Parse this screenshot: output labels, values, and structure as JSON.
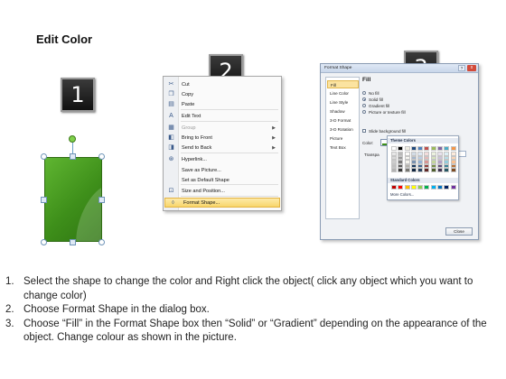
{
  "title": "Edit Color",
  "badges": [
    "1",
    "2",
    "3"
  ],
  "context_menu": {
    "items": [
      {
        "label": "Cut",
        "icon": "scissors-icon",
        "glyph": "✂"
      },
      {
        "label": "Copy",
        "icon": "copy-icon",
        "glyph": "❐"
      },
      {
        "label": "Paste",
        "icon": "paste-icon",
        "glyph": "▤"
      },
      {
        "label": "Edit Text",
        "icon": "edit-text-icon",
        "glyph": "A"
      },
      {
        "label": "Group",
        "icon": "group-icon",
        "glyph": "▦",
        "submenu": true,
        "disabled": true
      },
      {
        "label": "Bring to Front",
        "icon": "bring-to-front-icon",
        "glyph": "◧",
        "submenu": true
      },
      {
        "label": "Send to Back",
        "icon": "send-to-back-icon",
        "glyph": "◨",
        "submenu": true
      },
      {
        "label": "Hyperlink...",
        "icon": "hyperlink-icon",
        "glyph": "⊛"
      },
      {
        "label": "Save as Picture...",
        "icon": "",
        "glyph": ""
      },
      {
        "label": "Set as Default Shape",
        "icon": "",
        "glyph": ""
      },
      {
        "label": "Size and Position...",
        "icon": "size-position-icon",
        "glyph": "⊡"
      },
      {
        "label": "Format Shape...",
        "icon": "format-shape-icon",
        "glyph": "⬨",
        "highlighted": true
      }
    ]
  },
  "dialog": {
    "title": "Format Shape",
    "help": "?",
    "close_x": "x",
    "nav": [
      "Fill",
      "Line Color",
      "Line Style",
      "Shadow",
      "3-D Format",
      "3-D Rotation",
      "Picture",
      "Text Box"
    ],
    "panel_title": "Fill",
    "fill_options": [
      {
        "label": "No fill",
        "selected": false
      },
      {
        "label": "Solid fill",
        "selected": true
      },
      {
        "label": "Gradient fill",
        "selected": false
      },
      {
        "label": "Picture or texture fill",
        "selected": false
      }
    ],
    "slide_background": "Slide background fill",
    "color_label": "Color:",
    "transparency_label": "Transpa",
    "close_button": "Close"
  },
  "palette": {
    "theme_label": "Theme Colors",
    "standard_label": "Standard Colors",
    "more": "More Colors...",
    "theme_columns": [
      "#ffffff",
      "#000000",
      "#eeece1",
      "#1f497d",
      "#4f81bd",
      "#c0504d",
      "#9bbb59",
      "#8064a2",
      "#4bacc6",
      "#f79646"
    ],
    "standard": [
      "#c00000",
      "#ff0000",
      "#ffc000",
      "#ffff00",
      "#92d050",
      "#00b050",
      "#00b0f0",
      "#0070c0",
      "#002060",
      "#7030a0"
    ]
  },
  "steps": [
    {
      "num": "1.",
      "text": "Select the shape to change the color and Right click the object( click any object which you want to change color)"
    },
    {
      "num": "2.",
      "text": "Choose Format Shape in the dialog box."
    },
    {
      "num": "3.",
      "text": "Choose “Fill” in the Format Shape box then “Solid” or “Gradient” depending on the appearance of the object. Change colour as shown in the picture."
    }
  ]
}
